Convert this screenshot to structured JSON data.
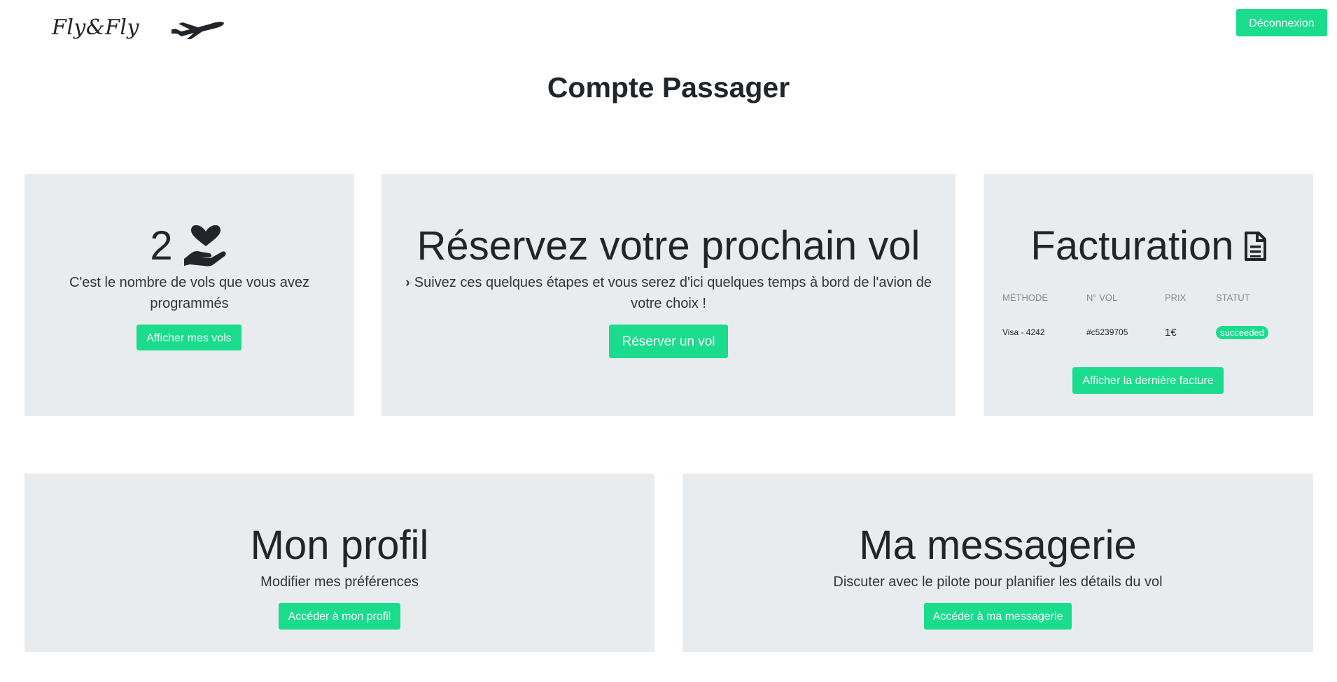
{
  "header": {
    "logo": "Fly&Fly",
    "logout_label": "Déconnexion"
  },
  "page": {
    "title": "Compte Passager"
  },
  "flights_card": {
    "count": "2",
    "description": "C'est le nombre de vols que vous avez programmés",
    "button_label": "Afficher mes vols",
    "icon": "hand-holding-heart-icon"
  },
  "booking_card": {
    "title": "Réservez votre prochain vol",
    "description": "Suivez ces quelques étapes et vous serez d'ici quelques temps à bord de l'avion de votre choix !",
    "button_label": "Réserver un vol"
  },
  "billing_card": {
    "title": "Facturation",
    "icon": "file-icon",
    "columns": [
      "MÉTHODE",
      "N° VOL",
      "PRIX",
      "STATUT"
    ],
    "rows": [
      {
        "method": "Visa - 4242",
        "flight_no": "#c5239705",
        "price": "1€",
        "status": "succeeded"
      }
    ],
    "button_label": "Afficher la dernière facture"
  },
  "profile_card": {
    "title": "Mon profil",
    "description": "Modifier mes préférences",
    "button_label": "Accéder à mon profil"
  },
  "inbox_card": {
    "title": "Ma messagerie",
    "description": "Discuter avec le pilote pour planifier les détails du vol",
    "button_label": "Accéder à ma messagerie"
  },
  "colors": {
    "accent": "#1adc8c",
    "card_bg": "#e9ecef",
    "text": "#212529"
  }
}
